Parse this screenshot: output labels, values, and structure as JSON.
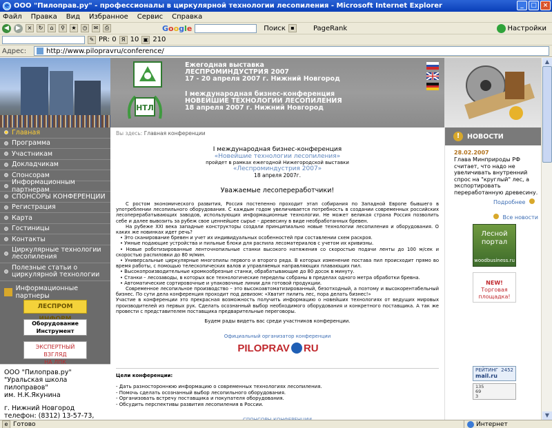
{
  "window": {
    "title": "ООО \"Пилоправ.ру\" - профессионалы в циркулярной технологии лесопиления - Microsoft Internet Explorer"
  },
  "menu": [
    "Файл",
    "Правка",
    "Вид",
    "Избранное",
    "Сервис",
    "Справка"
  ],
  "toolbar": {
    "google_search": "Google",
    "search_label": "Поиск",
    "pagerank_label": "PageRank",
    "settings_label": "Настройки"
  },
  "toolbar2": {
    "pr_label": "PR: 0",
    "y_count": "10",
    "count2": "210"
  },
  "address": {
    "label": "Адрес:",
    "url": "http://www.pilopravru/conference/"
  },
  "header": {
    "exhibition_line1": "Ежегодная выставка",
    "exhibition_line2": "ЛЕСПРОМИНДУСТРИЯ 2007",
    "exhibition_line3": "17 - 20 апреля 2007 г. Нижний Новгород",
    "conference_line1": "I международная бизнес-конференция",
    "conference_line2": "НОВЕЙШИЕ ТЕХНОЛОГИИ ЛЕСОПИЛЕНИЯ",
    "conference_line3": "18 апреля 2007 г. Нижний Новгород",
    "logo_badge": "НТЛ"
  },
  "nav": {
    "items": [
      "Главная",
      "Программа",
      "Участникам",
      "Докладчикам",
      "Спонсорам",
      "Информационным партнерам",
      "СПОНСОРЫ КОНФЕРЕНЦИИ",
      "Регистрация",
      "Карта",
      "Гостиницы",
      "Контакты",
      "Циркулярные технологии лесопиления",
      "Полезные статьи о циркулярной технологии"
    ],
    "partners_heading": "Информационные партнеры",
    "partner1": "ЛЕСПРОМ ИНФОРМ",
    "partner2": "Оборудование Инструмент",
    "partner3_line1": "ЭКСПЕРТНЫЙ ВЗГЛЯД",
    "partner3_line2": "НА ЛПК"
  },
  "company": {
    "name": "ООО \"Пилоправ.ру\"",
    "school": "\"Уральская школа пилоправов\"",
    "person": "им. Н.К.Якунина",
    "city": "г. Нижний Новгород",
    "phone": "телефон: (8312) 13-57-73, 13-"
  },
  "main": {
    "breadcrumb_label": "Вы здесь:",
    "breadcrumb_page": "Главная конференции",
    "conf_title": "I международная бизнес-конференция",
    "conf_name": "«Новейшие технологии лесопиления»",
    "conf_within": "пройдет в рамках ежегодной Нижегородской выставки",
    "conf_exhibition": "«Леспроминдустрия 2007»",
    "conf_date": "18 апреля 2007г.",
    "greeting": "Уважаемые лесопереработчики!",
    "p1": "С ростом экономического развития, Россия постепенно проходит этап собирания по Западной Европе бывшего в употреблении лесопильного оборудования. С каждым годом увеличивается потребность в создании современных российских лесоперерабатывающих заводов, использующих информационные технологии. Не может великая страна Россия позволить себе и далее вывозить за рубеж свое ценнейшее сырье – древесину в виде необработанных бревен.",
    "p2": "На рубеже XXI века западные конструкторы создали принципиально новые технологии лесопиления и оборудования. О каких же новинках идет речь?",
    "bullet1": "• Это сканирование бревен и учет их индивидуальных особенностей при составлении схем раскроя.",
    "bullet2": "• Умные подающие устройства и пильные блоки для распила лесоматериалов с учетом их кривизны.",
    "bullet3": "• Новые роботизированные ленточнопильные станки высокого натяжения со скоростью подачи ленты до 100 м/сек и скоростью распиловки до 80 м/мин.",
    "bullet4": "• Универсальные циркулярные многопилы первого и второго ряда. В которых изменение постава пил происходит прямо во время работы, с помощью телескопических валов и управляемых направляющих плавающих пил.",
    "bullet5": "• Высокопроизводительные кромкообрезные станки, обрабатывающие до 80 досок в минуту.",
    "bullet6": "• Станки – лесозаводы, в которых все технологические переделы собраны в пределах одного метра обработки бревна.",
    "bullet7": "• Автоматические сортировочные и упаковочные линии для готовой продукции.",
    "p3": "Современное лесопильное производство – это высокоавтоматизированный, безотходный, а поэтому и высокорентабельный бизнес. По сути дела конференция проходит под девизом: «Хватит пилить лес, пора делать бизнес!»",
    "p4": "Участие в конференции это прекрасная возможность получить информацию о новейших технологиях от ведущих мировых производителей из первых рук. Сделать осознанный выбор необходимого оборудования и конкретного поставщика. А так же провести с представителем поставщика предварительные переговоры.",
    "see_you": "Будем рады видеть вас среди участников конференции.",
    "organizer": "Официальный организатор конференции",
    "org_logo_left": "PILOPRAV",
    "org_logo_right": "RU",
    "goals_head": "Цели конференции:",
    "goal1": "- Дать разностороннюю информацию о современных технологиях лесопиления.",
    "goal2": "- Помочь сделать осознанный выбор лесопильного оборудования.",
    "goal3": "- Организовать встречу поставщика и покупателя оборудования.",
    "goal4": "- Обсудить перспективы развития лесопиления в России.",
    "sponsors_link": "СПОНСОРЫ КОНФЕРЕНЦИИ"
  },
  "news": {
    "heading": "НОВОСТИ",
    "date": "28.02.2007",
    "text": "Глава Минприроды РФ считает, что надо не увеличивать внутренний спрос на \"круглый\" лес, а экспортировать переработанную древесину.",
    "more": "Подробнее",
    "all": "Все новости",
    "banner1_line1": "Лесной",
    "banner1_line2": "портал",
    "banner1_site": "woodbusiness.ru",
    "banner2_new": "NEW!",
    "banner2_text": "Торговая площадка!",
    "counter_label": "РЕЙТИНГ",
    "counter_value": "2452",
    "counter_brand": "mail.ru",
    "counter2_a": "135",
    "counter2_b": "69",
    "counter2_c": "3"
  },
  "status": {
    "text": "Готово",
    "zone": "Интернет"
  }
}
